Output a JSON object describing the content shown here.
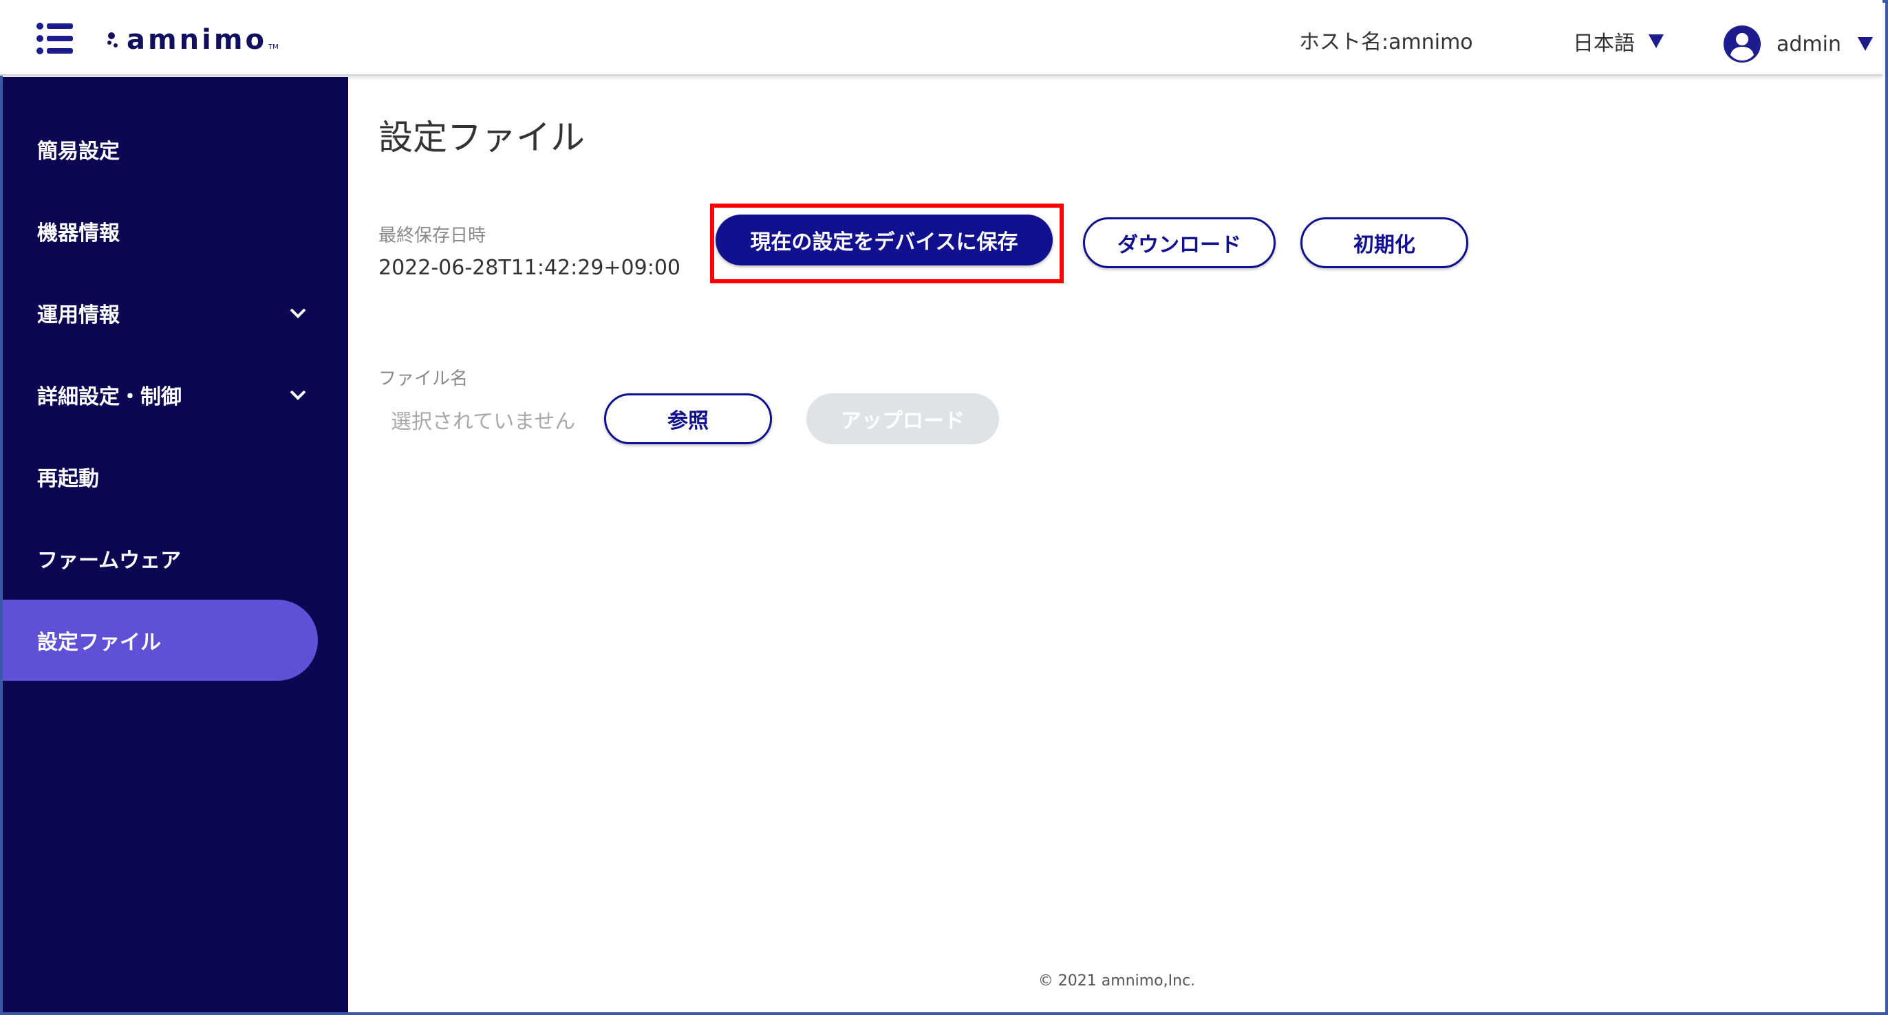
{
  "header": {
    "logo_text": "amnimo",
    "logo_tm": "TM",
    "hostname": "ホスト名:amnimo",
    "language": "日本語",
    "user": "admin"
  },
  "sidebar": {
    "items": [
      {
        "label": "簡易設定",
        "has_chevron": false
      },
      {
        "label": "機器情報",
        "has_chevron": false
      },
      {
        "label": "運用情報",
        "has_chevron": true
      },
      {
        "label": "詳細設定・制御",
        "has_chevron": true
      },
      {
        "label": "再起動",
        "has_chevron": false
      },
      {
        "label": "ファームウェア",
        "has_chevron": false
      },
      {
        "label": "設定ファイル",
        "has_chevron": false,
        "active": true
      }
    ]
  },
  "main": {
    "title": "設定ファイル",
    "last_saved_label": "最終保存日時",
    "last_saved_value": "2022-06-28T11:42:29+09:00",
    "save_button": "現在の設定をデバイスに保存",
    "download_button": "ダウンロード",
    "initialize_button": "初期化",
    "file_name_label": "ファイル名",
    "file_placeholder": "選択されていません",
    "browse_button": "参照",
    "upload_button": "アップロード"
  },
  "footer": {
    "copyright": "© 2021 amnimo,Inc."
  },
  "colors": {
    "sidebar_bg": "#0b0752",
    "sidebar_active": "#5e51d6",
    "primary": "#11118f",
    "highlight": "#ff0000",
    "disabled": "#dfe3e6"
  },
  "icons": {
    "menu": "list-menu-icon",
    "user": "account-circle-icon",
    "language_caret": "triangle-down-icon",
    "nav_chevron": "chevron-down-icon"
  }
}
